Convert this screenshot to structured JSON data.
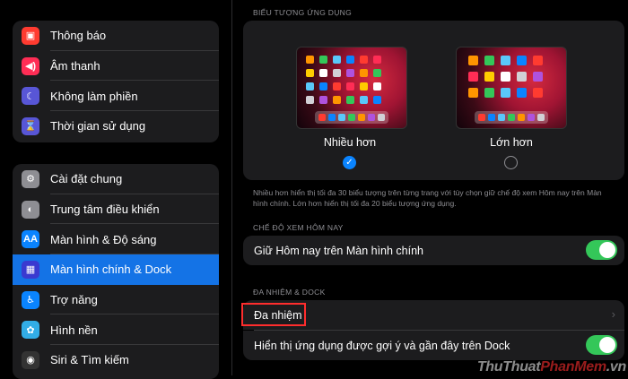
{
  "sidebar": {
    "group1": [
      {
        "label": "Thông báo",
        "icon": "notifications-icon",
        "color": "#ff3b30",
        "glyph": "▣"
      },
      {
        "label": "Âm thanh",
        "icon": "sound-icon",
        "color": "#ff2d55",
        "glyph": "◀)"
      },
      {
        "label": "Không làm phiền",
        "icon": "moon-icon",
        "color": "#5856d6",
        "glyph": "☾"
      },
      {
        "label": "Thời gian sử dụng",
        "icon": "hourglass-icon",
        "color": "#5856d6",
        "glyph": "⌛"
      }
    ],
    "group2": [
      {
        "label": "Cài đặt chung",
        "icon": "gear-icon",
        "color": "#8e8e93",
        "glyph": "⚙"
      },
      {
        "label": "Trung tâm điều khiển",
        "icon": "toggles-icon",
        "color": "#8e8e93",
        "glyph": "◐"
      },
      {
        "label": "Màn hình & Độ sáng",
        "icon": "display-icon",
        "color": "#0a84ff",
        "glyph": "AA"
      },
      {
        "label": "Màn hình chính & Dock",
        "icon": "home-grid-icon",
        "color": "#3a3ad0",
        "glyph": "▦"
      },
      {
        "label": "Trợ năng",
        "icon": "accessibility-icon",
        "color": "#0a84ff",
        "glyph": "♿"
      },
      {
        "label": "Hình nền",
        "icon": "wallpaper-icon",
        "color": "#32ade6",
        "glyph": "✿"
      },
      {
        "label": "Siri & Tìm kiếm",
        "icon": "siri-icon",
        "color": "#333333",
        "glyph": "◉"
      }
    ]
  },
  "main": {
    "icons_section_title": "BIỂU TƯỢNG ỨNG DỤNG",
    "option_more": "Nhiều hơn",
    "option_bigger": "Lớn hơn",
    "icons_footnote": "Nhiều hơn hiển thị tối đa 30 biểu tượng trên từng trang với tùy chọn giữ chế độ xem Hôm nay trên Màn hình chính. Lớn hơn hiển thị tối đa 20 biểu tượng ứng dụng.",
    "today_section_title": "CHẾ ĐỘ XEM HÔM NAY",
    "keep_today_label": "Giữ Hôm nay trên Màn hình chính",
    "multitask_section_title": "ĐA NHIỆM & DOCK",
    "multitask_label": "Đa nhiệm",
    "suggested_apps_label": "Hiển thị ứng dụng được gợi ý và gần đây trên Dock",
    "watermark_1": "ThuThuat",
    "watermark_2": "PhanMem",
    "watermark_3": ".vn",
    "colors": {
      "accent": "#0a84ff",
      "toggle_on": "#34c759",
      "selected": "#1473e6",
      "highlight": "#ff2d2d"
    }
  }
}
